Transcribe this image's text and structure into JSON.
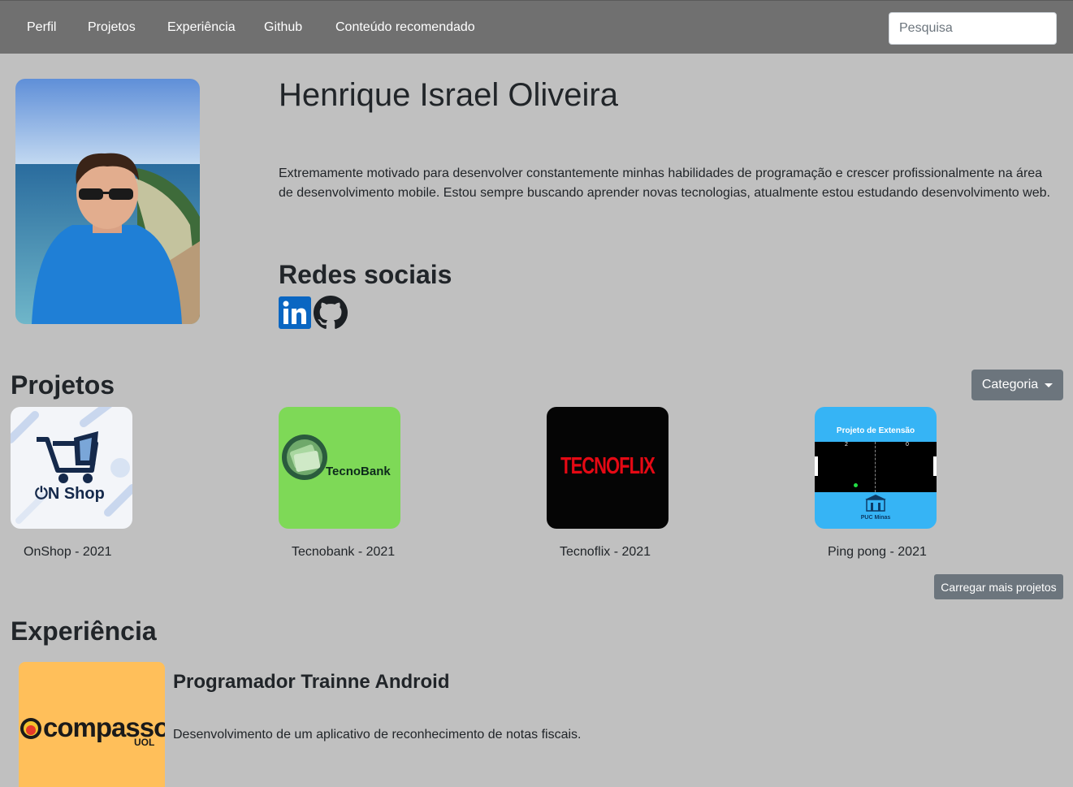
{
  "nav": {
    "items": [
      "Perfil",
      "Projetos",
      "Experiência",
      "Github",
      "Conteúdo recomendado"
    ],
    "search_placeholder": "Pesquisa"
  },
  "profile": {
    "name": "Henrique Israel Oliveira",
    "description": "Extremamente motivado para desenvolver constantemente minhas habilidades de programação e crescer profissionalmente na área de desenvolvimento mobile. Estou sempre buscando aprender novas tecnologias, atualmente estou estudando desenvolvimento web.",
    "social_title": "Redes sociais",
    "social_icons": [
      "linkedin-icon",
      "github-icon"
    ]
  },
  "projects": {
    "title": "Projetos",
    "category_label": "Categoria",
    "items": [
      {
        "caption": "OnShop - 2021",
        "logo_text": "N Shop"
      },
      {
        "caption": "Tecnobank - 2021",
        "logo_text": "TecnoBank"
      },
      {
        "caption": "Tecnoflix - 2021",
        "logo_text": "TECNOFLIX"
      },
      {
        "caption": "Ping pong - 2021",
        "logo_text": "Projeto de Extensão",
        "score_left": "2",
        "score_right": "0",
        "footer": "PUC Minas"
      }
    ],
    "more_label": "Carregar mais projetos"
  },
  "experience": {
    "title": "Experiência",
    "items": [
      {
        "role": "Programador Trainne Android",
        "description": "Desenvolvimento de um aplicativo de reconhecimento de notas fiscais.",
        "logo_text": "compasso",
        "logo_sub": "UOL"
      }
    ]
  },
  "colors": {
    "background": "#c0c0c0",
    "navbar": "#707070",
    "button": "#6c757d",
    "linkedin": "#0a66c2"
  }
}
